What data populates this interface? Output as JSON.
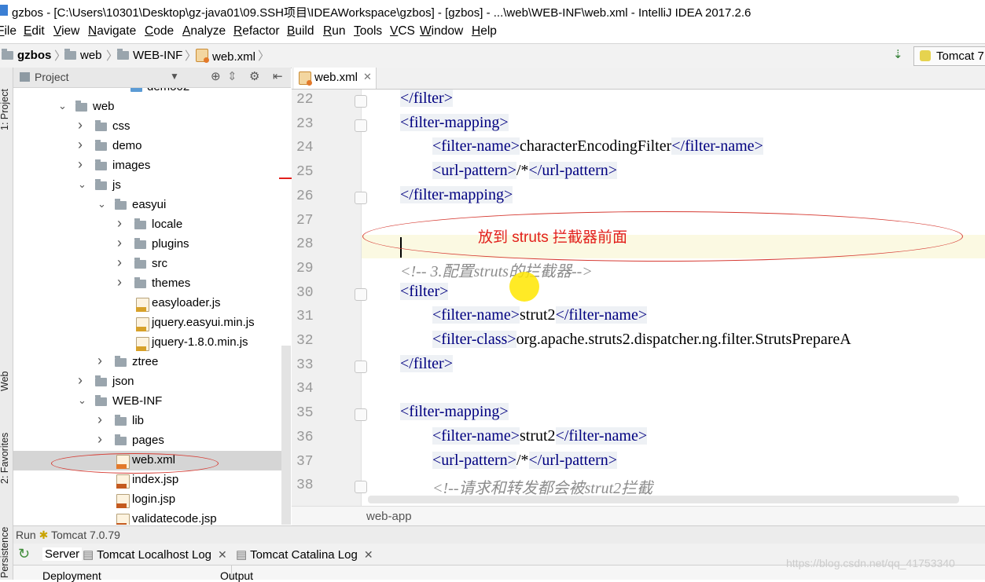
{
  "window": {
    "title": "gzbos - [C:\\Users\\10301\\Desktop\\gz-java01\\09.SSH项目\\IDEAWorkspace\\gzbos] - [gzbos] - ...\\web\\WEB-INF\\web.xml - IntelliJ IDEA 2017.2.6"
  },
  "menu": [
    "File",
    "Edit",
    "View",
    "Navigate",
    "Code",
    "Analyze",
    "Refactor",
    "Build",
    "Run",
    "Tools",
    "VCS",
    "Window",
    "Help"
  ],
  "breadcrumbs": [
    "gzbos",
    "web",
    "WEB-INF",
    "web.xml"
  ],
  "run_config": "Tomcat 7",
  "left_strip": [
    "1: Project",
    "Web",
    "2: Favorites",
    "Persistence"
  ],
  "project_panel": {
    "title": "Project",
    "tree": [
      {
        "label": "demo02",
        "indent": 4,
        "type": "cut"
      },
      {
        "label": "web",
        "indent": 1,
        "type": "folder",
        "arrow": "open"
      },
      {
        "label": "css",
        "indent": 2,
        "type": "folder",
        "arrow": "closed"
      },
      {
        "label": "demo",
        "indent": 2,
        "type": "folder",
        "arrow": "closed"
      },
      {
        "label": "images",
        "indent": 2,
        "type": "folder",
        "arrow": "closed"
      },
      {
        "label": "js",
        "indent": 2,
        "type": "folder",
        "arrow": "open"
      },
      {
        "label": "easyui",
        "indent": 3,
        "type": "folder",
        "arrow": "open"
      },
      {
        "label": "locale",
        "indent": 4,
        "type": "folder",
        "arrow": "closed"
      },
      {
        "label": "plugins",
        "indent": 4,
        "type": "folder",
        "arrow": "closed"
      },
      {
        "label": "src",
        "indent": 4,
        "type": "folder",
        "arrow": "closed"
      },
      {
        "label": "themes",
        "indent": 4,
        "type": "folder",
        "arrow": "closed"
      },
      {
        "label": "easyloader.js",
        "indent": 4,
        "type": "js"
      },
      {
        "label": "jquery.easyui.min.js",
        "indent": 4,
        "type": "js"
      },
      {
        "label": "jquery-1.8.0.min.js",
        "indent": 4,
        "type": "js"
      },
      {
        "label": "ztree",
        "indent": 3,
        "type": "folder",
        "arrow": "closed"
      },
      {
        "label": "json",
        "indent": 2,
        "type": "folder",
        "arrow": "closed"
      },
      {
        "label": "WEB-INF",
        "indent": 2,
        "type": "folder",
        "arrow": "open"
      },
      {
        "label": "lib",
        "indent": 3,
        "type": "folder",
        "arrow": "closed"
      },
      {
        "label": "pages",
        "indent": 3,
        "type": "folder",
        "arrow": "closed"
      },
      {
        "label": "web.xml",
        "indent": 3,
        "type": "xml",
        "selected": true
      },
      {
        "label": "index.jsp",
        "indent": 3,
        "type": "jsp"
      },
      {
        "label": "login.jsp",
        "indent": 3,
        "type": "jsp"
      },
      {
        "label": "validatecode.jsp",
        "indent": 3,
        "type": "jsp"
      }
    ]
  },
  "editor": {
    "tab": "web.xml",
    "lines": [
      {
        "n": "22",
        "indent": 1,
        "parts": [
          [
            "t",
            "</filter>"
          ]
        ]
      },
      {
        "n": "23",
        "indent": 1,
        "parts": [
          [
            "t",
            "<filter-mapping>"
          ]
        ]
      },
      {
        "n": "24",
        "indent": 2,
        "parts": [
          [
            "t",
            "<filter-name>"
          ],
          [
            "x",
            "characterEncodingFilter"
          ],
          [
            "t",
            "</filter-name>"
          ]
        ]
      },
      {
        "n": "25",
        "indent": 2,
        "parts": [
          [
            "t",
            "<url-pattern>"
          ],
          [
            "x",
            "/*"
          ],
          [
            "t",
            "</url-pattern>"
          ]
        ]
      },
      {
        "n": "26",
        "indent": 1,
        "parts": [
          [
            "t",
            "</filter-mapping>"
          ]
        ]
      },
      {
        "n": "27",
        "indent": 0,
        "parts": []
      },
      {
        "n": "28",
        "indent": 0,
        "parts": []
      },
      {
        "n": "29",
        "indent": 1,
        "parts": [
          [
            "c",
            "<!-- 3.配置struts的拦截器-->"
          ]
        ]
      },
      {
        "n": "30",
        "indent": 1,
        "parts": [
          [
            "t",
            "<filter>"
          ]
        ]
      },
      {
        "n": "31",
        "indent": 2,
        "parts": [
          [
            "t",
            "<filter-name>"
          ],
          [
            "x",
            "strut2"
          ],
          [
            "t",
            "</filter-name>"
          ]
        ]
      },
      {
        "n": "32",
        "indent": 2,
        "parts": [
          [
            "t",
            "<filter-class>"
          ],
          [
            "x",
            "org.apache.struts2.dispatcher.ng.filter.StrutsPrepareA"
          ]
        ]
      },
      {
        "n": "33",
        "indent": 1,
        "parts": [
          [
            "t",
            "</filter>"
          ]
        ]
      },
      {
        "n": "34",
        "indent": 0,
        "parts": []
      },
      {
        "n": "35",
        "indent": 1,
        "parts": [
          [
            "t",
            "<filter-mapping>"
          ]
        ]
      },
      {
        "n": "36",
        "indent": 2,
        "parts": [
          [
            "t",
            "<filter-name>"
          ],
          [
            "x",
            "strut2"
          ],
          [
            "t",
            "</filter-name>"
          ]
        ]
      },
      {
        "n": "37",
        "indent": 2,
        "parts": [
          [
            "t",
            "<url-pattern>"
          ],
          [
            "x",
            "/*"
          ],
          [
            "t",
            "</url-pattern>"
          ]
        ]
      },
      {
        "n": "38",
        "indent": 2,
        "parts": [
          [
            "c",
            "<!--请求和转发都会被strut2拦截"
          ]
        ]
      }
    ],
    "fold_lines": [
      "22",
      "23",
      "26",
      "30",
      "33",
      "35",
      "38"
    ],
    "breadcrumb_status": "web-app"
  },
  "annotation": "放到 struts 拦截器前面",
  "run_panel": {
    "header": "Run",
    "config": "Tomcat 7.0.79",
    "tabs": [
      "Server",
      "Tomcat Localhost Log",
      "Tomcat Catalina Log"
    ],
    "columns": [
      "Deployment",
      "Output"
    ]
  },
  "watermark": "https://blog.csdn.net/qq_41753340"
}
